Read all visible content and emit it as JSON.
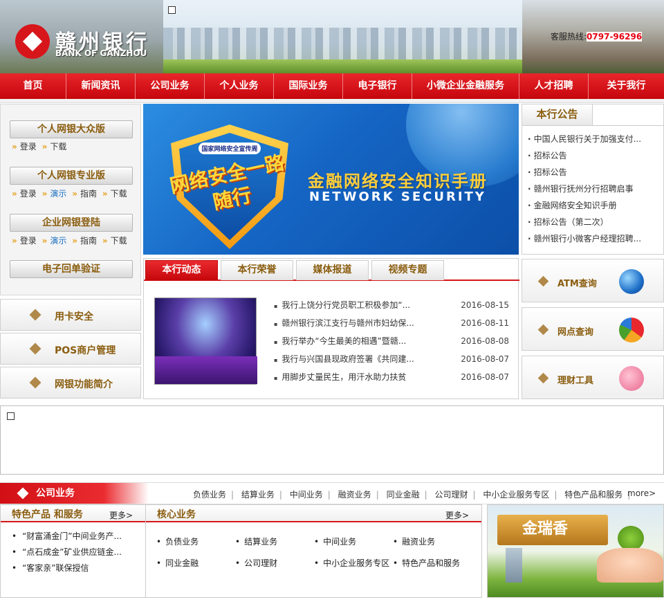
{
  "header": {
    "logo_cn": "赣州银行",
    "logo_en": "BANK OF GANZHOU",
    "hotline_label": "客服热线:",
    "hotline_number": "0797-96296"
  },
  "nav": {
    "items": [
      "首页",
      "新闻资讯",
      "公司业务",
      "个人业务",
      "国际业务",
      "电子银行",
      "小微企业金融服务",
      "人才招聘",
      "关于我行"
    ]
  },
  "ebank": {
    "personal_public": {
      "title": "个人网银大众版",
      "links": [
        "登录",
        "下载"
      ]
    },
    "personal_pro": {
      "title": "个人网银专业版",
      "links": [
        "登录",
        "演示",
        "指南",
        "下载"
      ]
    },
    "corporate": {
      "title": "企业网银登陆",
      "links": [
        "登录",
        "演示",
        "指南",
        "下载"
      ]
    },
    "receipt": "电子回单验证"
  },
  "left_tools": [
    "用卡安全",
    "POS商户管理",
    "网银功能简介"
  ],
  "banner": {
    "shield_top": "国家网络安全宣传周",
    "shield_text": "网络安全一路随行",
    "title": "金融网络安全知识手册",
    "subtitle": "NETWORK SECURITY"
  },
  "notice": {
    "title": "本行公告",
    "items": [
      "中国人民银行关于加强支付...",
      "招标公告",
      "招标公告",
      "赣州银行抚州分行招聘启事",
      "金融网络安全知识手册",
      "招标公告（第二次）",
      "赣州银行小微客户经理招聘..."
    ]
  },
  "news": {
    "tabs": [
      "本行动态",
      "本行荣誉",
      "媒体报道",
      "视频专题"
    ],
    "items": [
      {
        "title": "我行上饶分行党员职工积极参加“...",
        "date": "2016-08-15"
      },
      {
        "title": "赣州银行滨江支行与赣州市妇幼保...",
        "date": "2016-08-11"
      },
      {
        "title": "我行举办“今生最美的相遇”暨赣...",
        "date": "2016-08-08"
      },
      {
        "title": "我行与兴国县现政府签署《共同建...",
        "date": "2016-08-07"
      },
      {
        "title": "用脚步丈量民生，用汗水助力扶贫",
        "date": "2016-08-07"
      }
    ]
  },
  "right_tools": [
    "ATM查询",
    "网点查询",
    "理财工具"
  ],
  "corporate": {
    "title": "公司业务",
    "links": [
      "负债业务",
      "结算业务",
      "中间业务",
      "融资业务",
      "同业金融",
      "公司理财",
      "中小企业服务专区",
      "特色产品和服务"
    ],
    "more": "more>"
  },
  "featured": {
    "title": "特色产品 和服务",
    "more": "更多>",
    "items": [
      "“财富涌金门”中间业务产...",
      "“点石成金”矿业供应链金...",
      "“客家亲”联保授信"
    ]
  },
  "core": {
    "title": "核心业务",
    "more": "更多>",
    "items": [
      "负债业务",
      "结算业务",
      "中间业务",
      "融资业务",
      "同业金融",
      "公司理财",
      "中小企业服务专区",
      "特色产品和服务"
    ]
  },
  "promo": {
    "brand": "金瑞香"
  },
  "colors": {
    "brand_red": "#d71619",
    "gold_text": "#8a5d0f",
    "accent_orange": "#e4a11b"
  }
}
